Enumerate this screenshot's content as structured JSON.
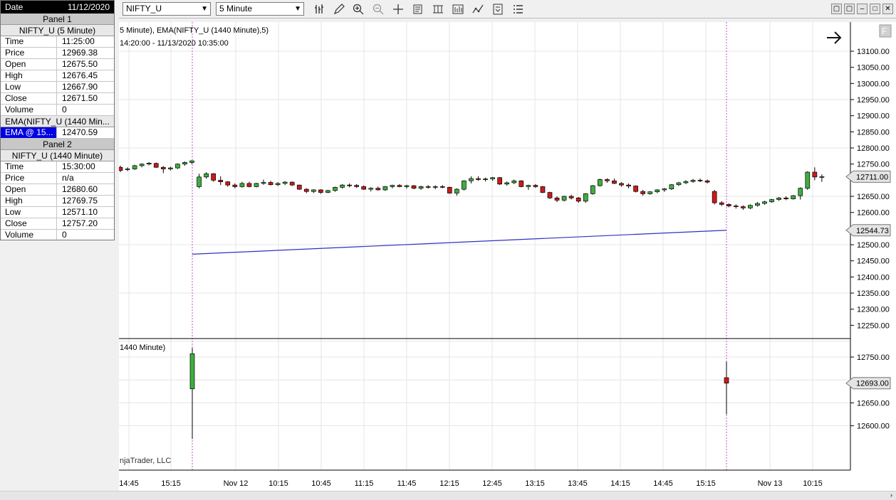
{
  "databox": {
    "header": {
      "key": "Date",
      "value": "11/12/2020"
    },
    "panel1": {
      "title": "Panel 1",
      "instrument": "NIFTY_U (5 Minute)",
      "rows": [
        {
          "k": "Time",
          "v": "11:25:00"
        },
        {
          "k": "Price",
          "v": "12969.38"
        },
        {
          "k": "Open",
          "v": "12675.50"
        },
        {
          "k": "High",
          "v": "12676.45"
        },
        {
          "k": "Low",
          "v": "12667.90"
        },
        {
          "k": "Close",
          "v": "12671.50"
        },
        {
          "k": "Volume",
          "v": "0"
        }
      ],
      "indicator": "EMA(NIFTY_U (1440 Min...",
      "indicator_row": {
        "k": "EMA @ 15...",
        "v": "12470.59"
      }
    },
    "panel2": {
      "title": "Panel 2",
      "instrument": "NIFTY_U (1440 Minute)",
      "rows": [
        {
          "k": "Time",
          "v": "15:30:00"
        },
        {
          "k": "Price",
          "v": "n/a"
        },
        {
          "k": "Open",
          "v": "12680.60"
        },
        {
          "k": "High",
          "v": "12769.75"
        },
        {
          "k": "Low",
          "v": "12571.10"
        },
        {
          "k": "Close",
          "v": "12757.20"
        },
        {
          "k": "Volume",
          "v": "0"
        }
      ]
    }
  },
  "toolbar": {
    "instrument": "NIFTY_U",
    "interval": "5 Minute",
    "icons": [
      "bar-style-icon",
      "pencil-icon",
      "zoom-in-icon",
      "zoom-out-icon",
      "crosshair-icon",
      "properties-icon",
      "data-box-icon",
      "chart-trader-icon",
      "indicators-icon",
      "strategies-icon",
      "instrument-list-icon"
    ]
  },
  "chart": {
    "label1": "5 Minute), EMA(NIFTY_U (1440 Minute),5)",
    "label2": "14:20:00 - 11/13/2020 10:35:00",
    "label_panel2": "1440 Minute)",
    "copyright": "njaTrader, LLC",
    "f_button": "F",
    "price_axis1": [
      "13100.00",
      "13050.00",
      "13000.00",
      "12950.00",
      "12900.00",
      "12850.00",
      "12800.00",
      "12750.00",
      "12650.00",
      "12600.00",
      "12500.00",
      "12450.00",
      "12400.00",
      "12350.00",
      "12300.00",
      "12250.00"
    ],
    "price_axis2": [
      "12750.00",
      "12650.00",
      "12600.00"
    ],
    "last_price1": "12711.00",
    "ema_price": "12544.73",
    "last_price2": "12693.00",
    "time_axis": [
      "14:45",
      "15:15",
      "Nov 12",
      "10:15",
      "10:45",
      "11:15",
      "11:45",
      "12:15",
      "12:45",
      "13:15",
      "13:45",
      "14:15",
      "14:45",
      "15:15",
      "Nov 13",
      "10:15"
    ],
    "colors": {
      "up": "#3fae3f",
      "down": "#cc1a1a",
      "ema": "#3030c0",
      "session": "#cc44cc"
    }
  },
  "chart_data": {
    "type": "candlestick",
    "xlabel": "",
    "ylabel": "",
    "ylim": [
      12210,
      13135
    ],
    "panel1_candles": [
      [
        12740,
        12745,
        12725,
        12730
      ],
      [
        12735,
        12740,
        12728,
        12735
      ],
      [
        12735,
        12748,
        12732,
        12745
      ],
      [
        12745,
        12752,
        12740,
        12750
      ],
      [
        12750,
        12756,
        12746,
        12753
      ],
      [
        12752,
        12755,
        12738,
        12740
      ],
      [
        12740,
        12744,
        12722,
        12735
      ],
      [
        12735,
        12742,
        12730,
        12738
      ],
      [
        12738,
        12752,
        12735,
        12750
      ],
      [
        12750,
        12758,
        12745,
        12755
      ],
      [
        12755,
        12762,
        12750,
        12760
      ],
      [
        12680,
        12720,
        12675,
        12710
      ],
      [
        12710,
        12725,
        12705,
        12720
      ],
      [
        12720,
        12722,
        12695,
        12700
      ],
      [
        12700,
        12712,
        12685,
        12695
      ],
      [
        12695,
        12697,
        12680,
        12685
      ],
      [
        12685,
        12690,
        12675,
        12680
      ],
      [
        12680,
        12695,
        12677,
        12690
      ],
      [
        12690,
        12695,
        12678,
        12680
      ],
      [
        12680,
        12692,
        12678,
        12690
      ],
      [
        12690,
        12702,
        12686,
        12693
      ],
      [
        12693,
        12698,
        12684,
        12686
      ],
      [
        12686,
        12694,
        12682,
        12690
      ],
      [
        12690,
        12697,
        12685,
        12694
      ],
      [
        12694,
        12696,
        12682,
        12685
      ],
      [
        12685,
        12686,
        12670,
        12672
      ],
      [
        12672,
        12675,
        12660,
        12665
      ],
      [
        12665,
        12672,
        12660,
        12670
      ],
      [
        12670,
        12672,
        12658,
        12662
      ],
      [
        12662,
        12670,
        12660,
        12668
      ],
      [
        12668,
        12680,
        12664,
        12678
      ],
      [
        12678,
        12688,
        12674,
        12685
      ],
      [
        12685,
        12690,
        12678,
        12684
      ],
      [
        12684,
        12688,
        12676,
        12680
      ],
      [
        12680,
        12684,
        12670,
        12672
      ],
      [
        12672,
        12678,
        12665,
        12675
      ],
      [
        12675,
        12680,
        12668,
        12670
      ],
      [
        12670,
        12682,
        12667,
        12680
      ],
      [
        12680,
        12686,
        12675,
        12684
      ],
      [
        12684,
        12688,
        12678,
        12680
      ],
      [
        12680,
        12686,
        12674,
        12683
      ],
      [
        12683,
        12685,
        12672,
        12675
      ],
      [
        12675,
        12683,
        12670,
        12680
      ],
      [
        12680,
        12685,
        12674,
        12678
      ],
      [
        12678,
        12684,
        12672,
        12680
      ],
      [
        12680,
        12685,
        12675,
        12678
      ],
      [
        12678,
        12680,
        12658,
        12660
      ],
      [
        12660,
        12675,
        12652,
        12672
      ],
      [
        12672,
        12700,
        12668,
        12698
      ],
      [
        12698,
        12712,
        12690,
        12705
      ],
      [
        12705,
        12712,
        12698,
        12702
      ],
      [
        12702,
        12708,
        12696,
        12704
      ],
      [
        12704,
        12710,
        12698,
        12708
      ],
      [
        12708,
        12710,
        12685,
        12688
      ],
      [
        12688,
        12696,
        12683,
        12692
      ],
      [
        12692,
        12702,
        12688,
        12698
      ],
      [
        12698,
        12700,
        12678,
        12680
      ],
      [
        12680,
        12686,
        12670,
        12684
      ],
      [
        12684,
        12688,
        12676,
        12680
      ],
      [
        12680,
        12682,
        12660,
        12662
      ],
      [
        12662,
        12664,
        12642,
        12645
      ],
      [
        12645,
        12650,
        12632,
        12638
      ],
      [
        12638,
        12652,
        12634,
        12650
      ],
      [
        12650,
        12655,
        12640,
        12645
      ],
      [
        12645,
        12648,
        12630,
        12635
      ],
      [
        12635,
        12660,
        12630,
        12658
      ],
      [
        12658,
        12685,
        12655,
        12683
      ],
      [
        12683,
        12705,
        12680,
        12702
      ],
      [
        12702,
        12706,
        12692,
        12698
      ],
      [
        12698,
        12705,
        12688,
        12690
      ],
      [
        12690,
        12694,
        12680,
        12685
      ],
      [
        12685,
        12690,
        12675,
        12682
      ],
      [
        12682,
        12684,
        12662,
        12665
      ],
      [
        12665,
        12670,
        12652,
        12658
      ],
      [
        12658,
        12666,
        12655,
        12664
      ],
      [
        12664,
        12672,
        12660,
        12670
      ],
      [
        12670,
        12676,
        12664,
        12673
      ],
      [
        12673,
        12688,
        12670,
        12686
      ],
      [
        12686,
        12695,
        12682,
        12692
      ],
      [
        12692,
        12700,
        12688,
        12696
      ],
      [
        12696,
        12704,
        12692,
        12700
      ],
      [
        12700,
        12705,
        12694,
        12698
      ],
      [
        12698,
        12702,
        12690,
        12694
      ],
      [
        12665,
        12670,
        12625,
        12630
      ],
      [
        12630,
        12635,
        12620,
        12625
      ],
      [
        12625,
        12628,
        12616,
        12620
      ],
      [
        12620,
        12625,
        12612,
        12618
      ],
      [
        12618,
        12622,
        12608,
        12614
      ],
      [
        12614,
        12625,
        12610,
        12622
      ],
      [
        12622,
        12632,
        12618,
        12628
      ],
      [
        12628,
        12636,
        12624,
        12633
      ],
      [
        12633,
        12642,
        12630,
        12640
      ],
      [
        12640,
        12648,
        12636,
        12645
      ],
      [
        12645,
        12650,
        12638,
        12642
      ],
      [
        12642,
        12654,
        12640,
        12652
      ],
      [
        12652,
        12678,
        12640,
        12675
      ],
      [
        12675,
        12728,
        12670,
        12725
      ],
      [
        12725,
        12740,
        12700,
        12710
      ],
      [
        12710,
        12718,
        12695,
        12711
      ]
    ],
    "panel2_candles": [
      [
        12680.6,
        12769.75,
        12571.1,
        12757.2
      ],
      [
        12705,
        12740,
        12625,
        12693
      ]
    ],
    "ema": [
      12470.59,
      12544.73
    ]
  }
}
